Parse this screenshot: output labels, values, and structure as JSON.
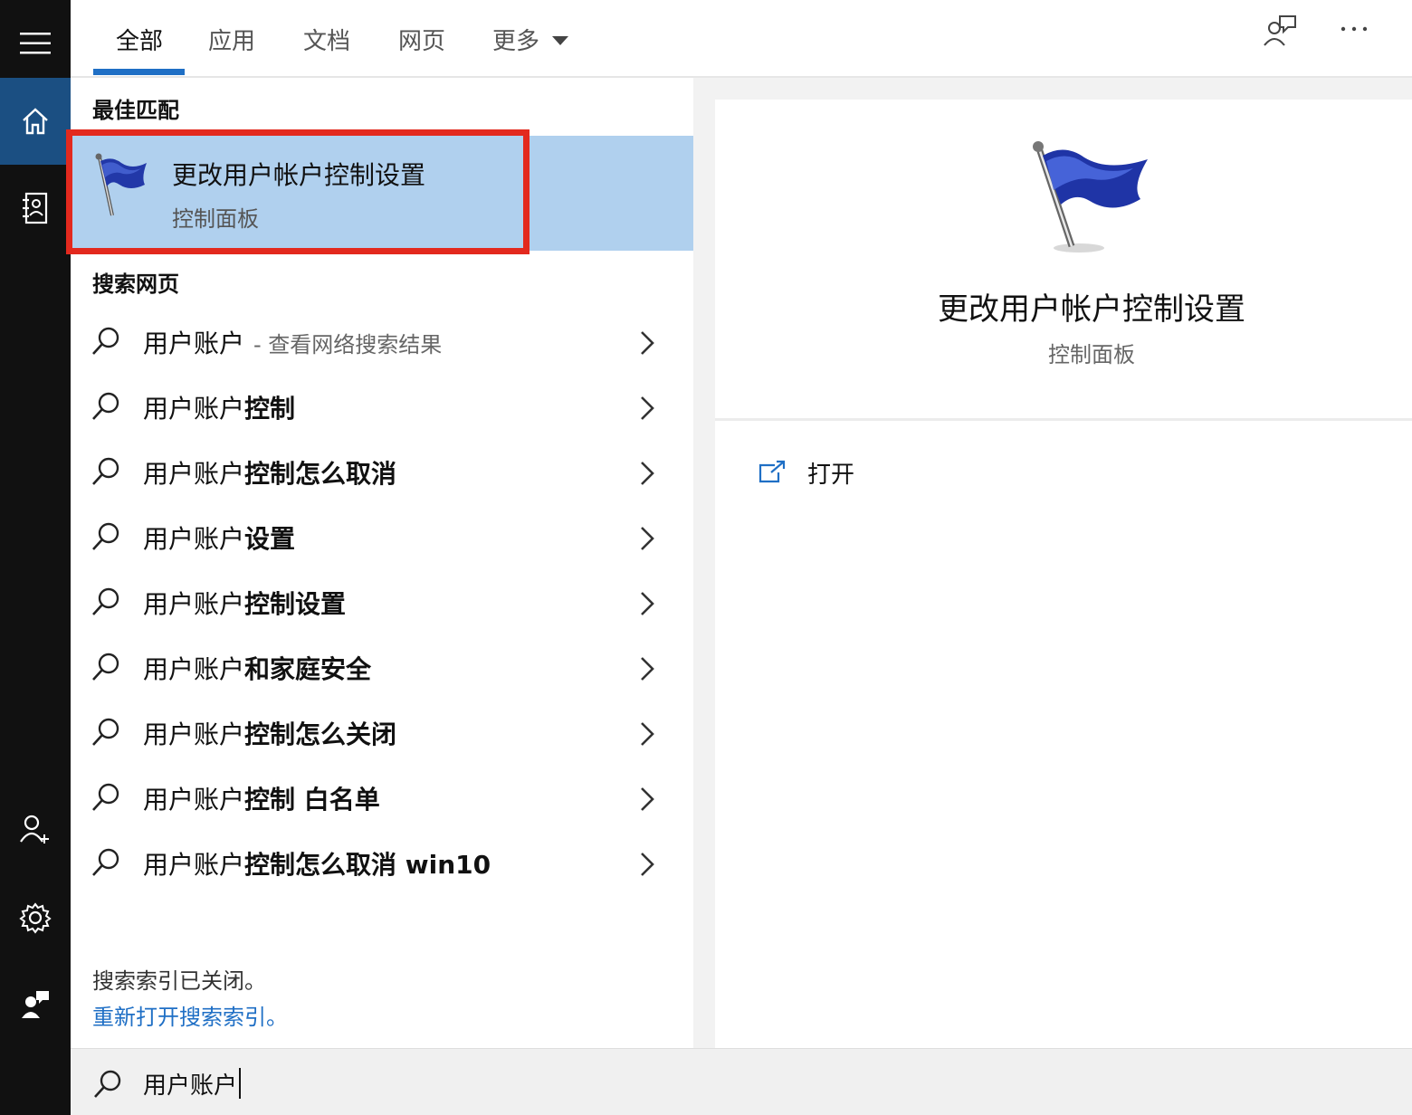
{
  "tabs": [
    {
      "label": "全部"
    },
    {
      "label": "应用"
    },
    {
      "label": "文档"
    },
    {
      "label": "网页"
    },
    {
      "label": "更多"
    }
  ],
  "active_tab": "全部",
  "best_match": {
    "section_title": "最佳匹配",
    "title": "更改用户帐户控制设置",
    "subtitle": "控制面板",
    "icon": "blue-flag-icon"
  },
  "web_search": {
    "section_title": "搜索网页",
    "items": [
      {
        "prefix": "用户账户",
        "bold": "",
        "suffix": "- 查看网络搜索结果"
      },
      {
        "prefix": "用户账户",
        "bold": "控制",
        "suffix": ""
      },
      {
        "prefix": "用户账户",
        "bold": "控制怎么取消",
        "suffix": ""
      },
      {
        "prefix": "用户账户",
        "bold": "设置",
        "suffix": ""
      },
      {
        "prefix": "用户账户",
        "bold": "控制设置",
        "suffix": ""
      },
      {
        "prefix": "用户账户",
        "bold": "和家庭安全",
        "suffix": ""
      },
      {
        "prefix": "用户账户",
        "bold": "控制怎么关闭",
        "suffix": ""
      },
      {
        "prefix": "用户账户",
        "bold": "控制 白名单",
        "suffix": ""
      },
      {
        "prefix": "用户账户",
        "bold": "控制怎么取消 win10",
        "suffix": ""
      }
    ]
  },
  "index_notice": {
    "text": "搜索索引已关闭。",
    "link": "重新打开搜索索引。"
  },
  "preview": {
    "title": "更改用户帐户控制设置",
    "subtitle": "控制面板",
    "actions": [
      {
        "label": "打开",
        "icon": "open-external-icon"
      }
    ]
  },
  "search": {
    "value": "用户账户"
  },
  "colors": {
    "rail_bg": "#111111",
    "rail_active": "#1b4f82",
    "selection_bg": "#b0d0ee",
    "highlight_border": "#e3291e",
    "accent": "#1f6fc5"
  }
}
